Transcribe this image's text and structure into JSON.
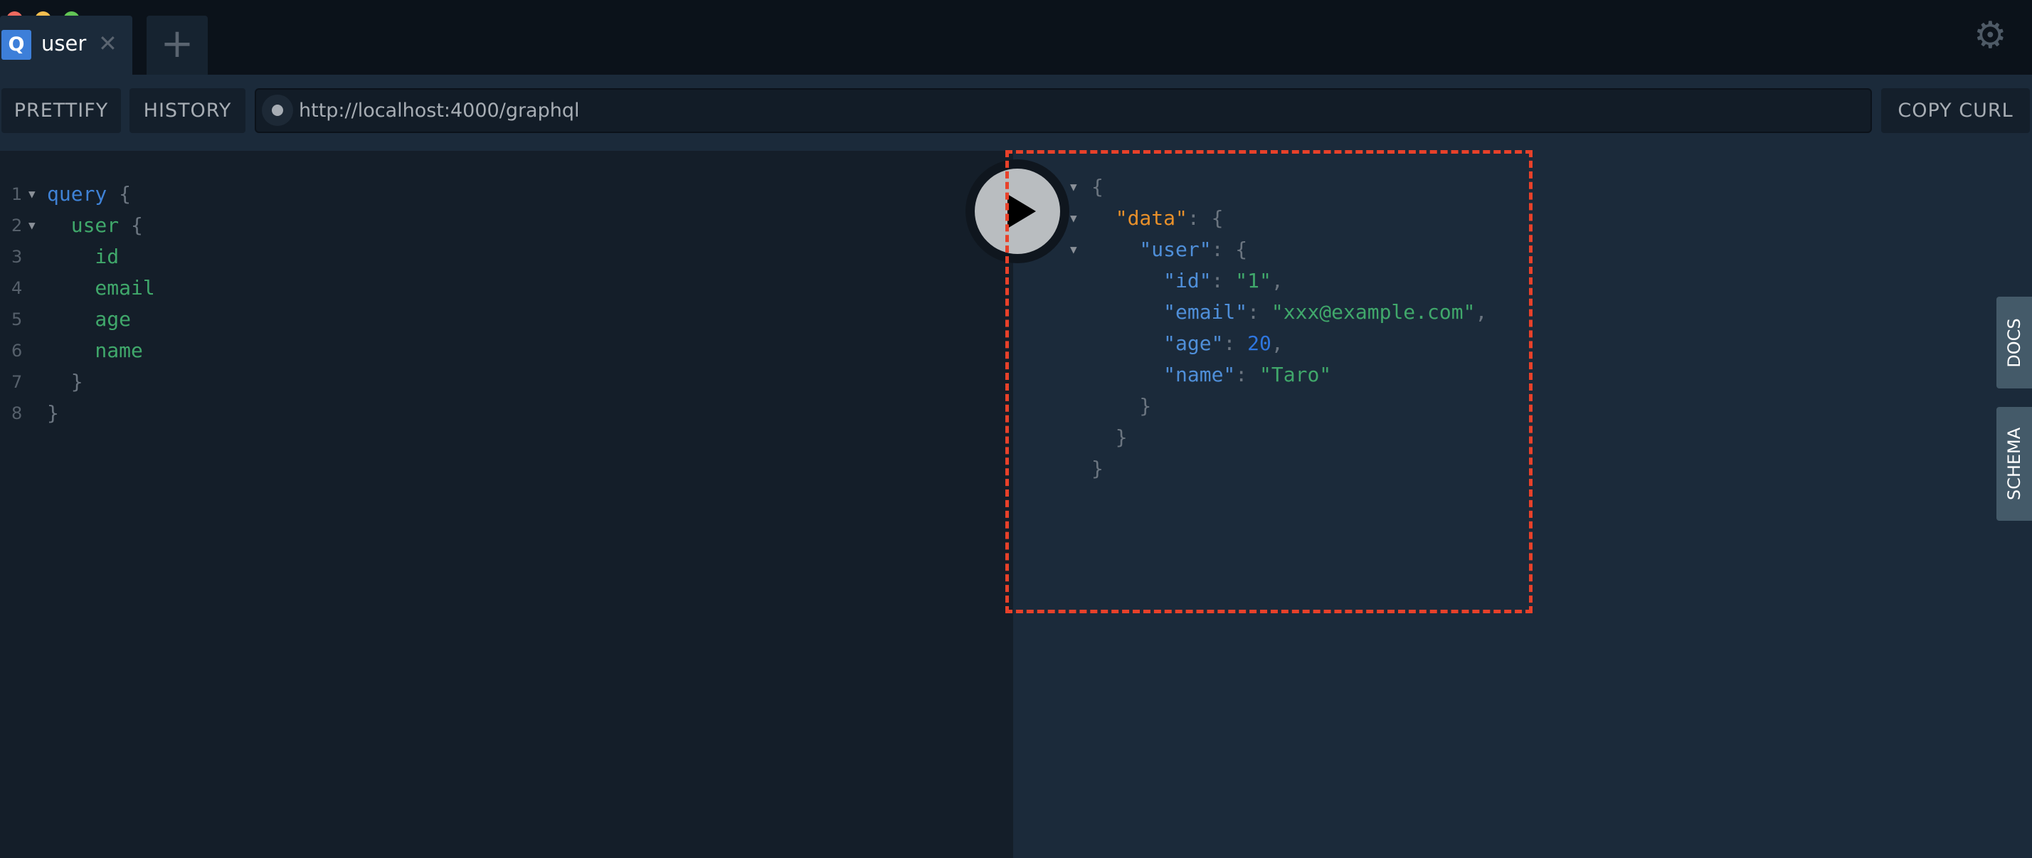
{
  "window": {
    "controls": [
      {
        "name": "close",
        "color": "#ee6a5f"
      },
      {
        "name": "minimize",
        "color": "#f5be4f"
      },
      {
        "name": "maximize",
        "color": "#62c555"
      }
    ]
  },
  "tabs": [
    {
      "badge": "Q",
      "label": "user",
      "close": "✕"
    }
  ],
  "new_tab": "+",
  "settings_icon": "gear-icon",
  "toolbar": {
    "prettify": "PRETTIFY",
    "history": "HISTORY",
    "url": "http://localhost:4000/graphql",
    "copy_curl": "COPY CURL"
  },
  "editor": {
    "lines": [
      {
        "n": "1",
        "fold": true,
        "parts": [
          [
            "kw",
            "query"
          ],
          [
            "pn",
            " {"
          ]
        ]
      },
      {
        "n": "2",
        "fold": true,
        "parts": [
          [
            "fld",
            "  user"
          ],
          [
            "pn",
            " {"
          ]
        ]
      },
      {
        "n": "3",
        "parts": [
          [
            "fld",
            "    id"
          ]
        ]
      },
      {
        "n": "4",
        "parts": [
          [
            "fld",
            "    email"
          ]
        ]
      },
      {
        "n": "5",
        "parts": [
          [
            "fld",
            "    age"
          ]
        ]
      },
      {
        "n": "6",
        "parts": [
          [
            "fld",
            "    name"
          ]
        ]
      },
      {
        "n": "7",
        "parts": [
          [
            "pn",
            "  }"
          ]
        ]
      },
      {
        "n": "8",
        "parts": [
          [
            "pn",
            "}"
          ]
        ]
      }
    ]
  },
  "result": {
    "lines": [
      {
        "fold": true,
        "parts": [
          [
            "pn",
            "{"
          ]
        ]
      },
      {
        "fold": true,
        "parts": [
          [
            "dk",
            "  \"data\""
          ],
          [
            "pn",
            ": {"
          ]
        ]
      },
      {
        "fold": true,
        "parts": [
          [
            "key",
            "    \"user\""
          ],
          [
            "pn",
            ": {"
          ]
        ]
      },
      {
        "parts": [
          [
            "key",
            "      \"id\""
          ],
          [
            "pn",
            ": "
          ],
          [
            "str",
            "\"1\""
          ],
          [
            "pn",
            ","
          ]
        ]
      },
      {
        "parts": [
          [
            "key",
            "      \"email\""
          ],
          [
            "pn",
            ": "
          ],
          [
            "str",
            "\"xxx@example.com\""
          ],
          [
            "pn",
            ","
          ]
        ]
      },
      {
        "parts": [
          [
            "key",
            "      \"age\""
          ],
          [
            "pn",
            ": "
          ],
          [
            "num",
            "20"
          ],
          [
            "pn",
            ","
          ]
        ]
      },
      {
        "parts": [
          [
            "key",
            "      \"name\""
          ],
          [
            "pn",
            ": "
          ],
          [
            "str",
            "\"Taro\""
          ]
        ]
      },
      {
        "parts": [
          [
            "pn",
            "    }"
          ]
        ]
      },
      {
        "parts": [
          [
            "pn",
            "  }"
          ]
        ]
      },
      {
        "parts": [
          [
            "pn",
            "}"
          ]
        ]
      }
    ]
  },
  "side_tabs": {
    "docs": "DOCS",
    "schema": "SCHEMA"
  },
  "colors": {
    "highlight_box": "#e8412a",
    "accent": "#3d7fd9"
  }
}
